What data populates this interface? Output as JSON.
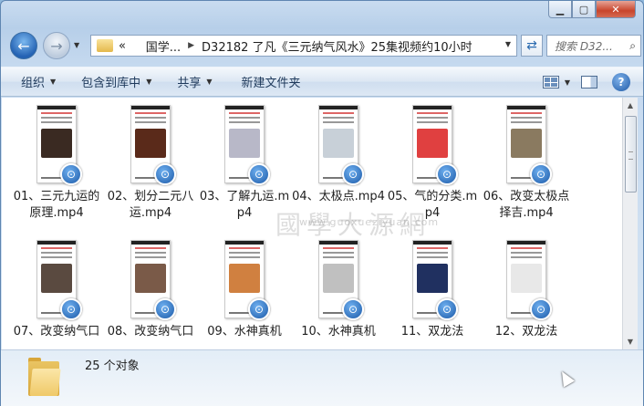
{
  "window": {
    "caption_buttons": [
      "minimize",
      "maximize",
      "close"
    ]
  },
  "nav": {
    "breadcrumb": [
      "«",
      "国学...",
      "D32182 了凡《三元纳气风水》25集视频约10小时"
    ],
    "search_placeholder": "搜索 D32..."
  },
  "toolbar": {
    "organize": "组织",
    "include_library": "包含到库中",
    "share": "共享",
    "new_folder": "新建文件夹"
  },
  "files": [
    {
      "label": "01、三元九运的原理.mp4",
      "art": "#3a2a22"
    },
    {
      "label": "02、划分二元八运.mp4",
      "art": "#5a2a1a"
    },
    {
      "label": "03、了解九运.mp4",
      "art": "#b8b8c8"
    },
    {
      "label": "04、太极点.mp4",
      "art": "#c8d0d8"
    },
    {
      "label": "05、气的分类.mp4",
      "art": "#e04040"
    },
    {
      "label": "06、改变太极点择吉.mp4",
      "art": "#8a7a60"
    },
    {
      "label": "07、改变纳气口",
      "art": "#5a4a40"
    },
    {
      "label": "08、改变纳气口",
      "art": "#7a5a48"
    },
    {
      "label": "09、水神真机",
      "art": "#d08040"
    },
    {
      "label": "10、水神真机",
      "art": "#c0c0c0"
    },
    {
      "label": "11、双龙法",
      "art": "#203060"
    },
    {
      "label": "12、双龙法",
      "art": "#e8e8e8"
    }
  ],
  "watermark": {
    "main": "國學大源網",
    "sub": "www.guoxueziyuan.com"
  },
  "details": {
    "count": "25 个对象"
  },
  "colors": {
    "accent": "#1c5aa8",
    "window_frame": "#b7cfe9"
  }
}
